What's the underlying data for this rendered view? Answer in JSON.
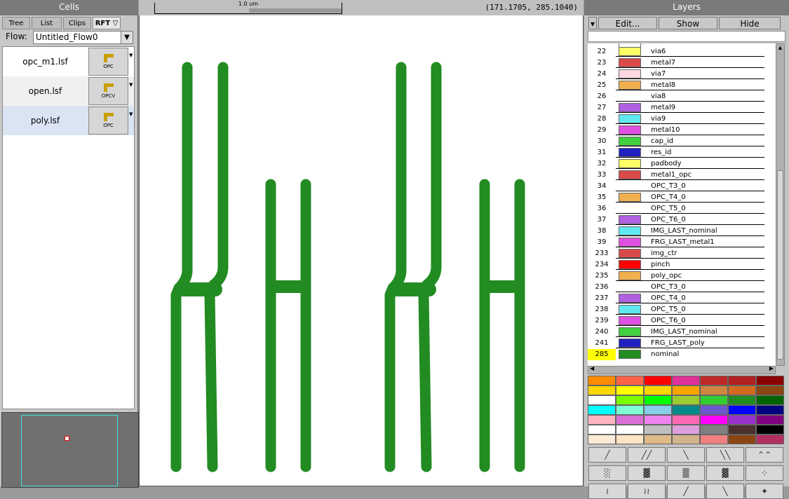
{
  "cells_panel": {
    "title": "Cells",
    "tabs": [
      "Tree",
      "List",
      "Clips",
      "RFT ▽"
    ],
    "flow_label": "Flow:",
    "flow_value": "Untitled_Flow0",
    "files": [
      {
        "name": "opc_m1.lsf",
        "button": "OPC"
      },
      {
        "name": "open.lsf",
        "button": "OPCV"
      },
      {
        "name": "poly.lsf",
        "button": "OPC"
      }
    ]
  },
  "canvas": {
    "scale_label": "1.0 um",
    "coords": "(171.1705, 285.1040)",
    "shape_color": "#228B22"
  },
  "layers_panel": {
    "title": "Layers",
    "buttons": [
      "Edit...",
      "Show",
      "Hide"
    ],
    "layers": [
      {
        "num": "22",
        "name": "via6",
        "color": "#ffff66"
      },
      {
        "num": "23",
        "name": "metal7",
        "color": "#d84a4a"
      },
      {
        "num": "24",
        "name": "via7",
        "color": "#ffd8e0"
      },
      {
        "num": "25",
        "name": "metal8",
        "color": "#f0b050"
      },
      {
        "num": "26",
        "name": "via8",
        "color": ""
      },
      {
        "num": "27",
        "name": "metal9",
        "color": "#b060e0"
      },
      {
        "num": "28",
        "name": "via9",
        "color": "#60e8f0"
      },
      {
        "num": "29",
        "name": "metal10",
        "color": "#e050e0"
      },
      {
        "num": "30",
        "name": "cap_id",
        "color": "#40d040"
      },
      {
        "num": "31",
        "name": "res_id",
        "color": "#2020c0"
      },
      {
        "num": "32",
        "name": "padbody",
        "color": "#ffff66"
      },
      {
        "num": "33",
        "name": "metal1_opc",
        "color": "#d84a4a"
      },
      {
        "num": "34",
        "name": "OPC_T3_0",
        "color": ""
      },
      {
        "num": "35",
        "name": "OPC_T4_0",
        "color": "#f0b050"
      },
      {
        "num": "36",
        "name": "OPC_T5_0",
        "color": ""
      },
      {
        "num": "37",
        "name": "OPC_T6_0",
        "color": "#b060e0"
      },
      {
        "num": "38",
        "name": "IMG_LAST_nominal",
        "color": "#60e8f0"
      },
      {
        "num": "39",
        "name": "FRG_LAST_metal1",
        "color": "#e050e0"
      },
      {
        "num": "233",
        "name": "img_ctr",
        "color": "#d84a4a"
      },
      {
        "num": "234",
        "name": "pinch",
        "color": "#ff0000"
      },
      {
        "num": "235",
        "name": "poly_opc",
        "color": "#f0b050"
      },
      {
        "num": "236",
        "name": "OPC_T3_0",
        "color": ""
      },
      {
        "num": "237",
        "name": "OPC_T4_0",
        "color": "#b060e0"
      },
      {
        "num": "238",
        "name": "OPC_T5_0",
        "color": "#60e8f0"
      },
      {
        "num": "239",
        "name": "OPC_T6_0",
        "color": "#e050e0"
      },
      {
        "num": "240",
        "name": "IMG_LAST_nominal",
        "color": "#40d040"
      },
      {
        "num": "241",
        "name": "FRG_LAST_poly",
        "color": "#2020c0"
      },
      {
        "num": "285",
        "name": "nominal",
        "color": "#228B22",
        "highlight": "#ffff00"
      }
    ],
    "palette": [
      [
        "#ff8c00",
        "#ff6347",
        "#ff0000",
        "#e0309a",
        "#c02828",
        "#b02020",
        "#8b0000"
      ],
      [
        "#ffd700",
        "#ffff00",
        "#ffd700",
        "#ffa500",
        "#cd853f",
        "#d2691e",
        "#8b4513"
      ],
      [
        "#ffffff",
        "#7cfc00",
        "#00ff00",
        "#9acd32",
        "#32cd32",
        "#228b22",
        "#006400"
      ],
      [
        "#00ffff",
        "#7fffd4",
        "#87ceeb",
        "#008b8b",
        "#6a5acd",
        "#0000ff",
        "#000080"
      ],
      [
        "#ffb6c1",
        "#da70d6",
        "#ee82ee",
        "#ff69b4",
        "#ff00ff",
        "#9932cc",
        "#800080"
      ],
      [
        "#ffffff",
        "#ffffff",
        "#c0c0c0",
        "#dda0dd",
        "#808080",
        "#4b2e2e",
        "#000000"
      ],
      [
        "#faebd7",
        "#ffe4c4",
        "#deb887",
        "#d2b48c",
        "#f08080",
        "#8b4513",
        "#b03060"
      ]
    ]
  }
}
